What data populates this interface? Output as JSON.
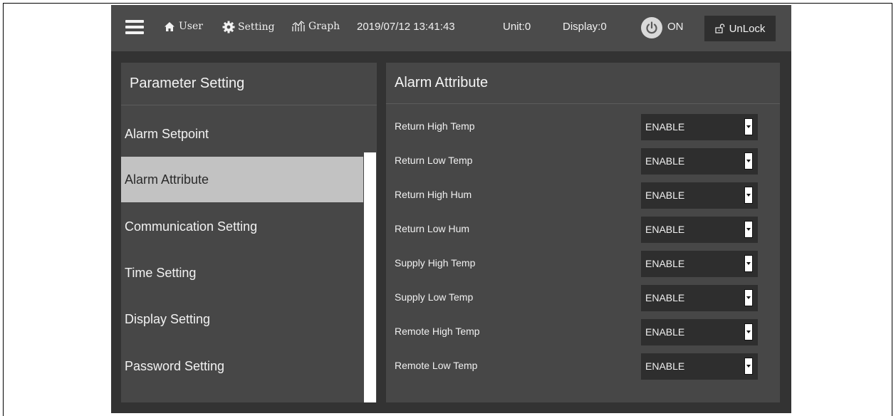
{
  "topbar": {
    "user_label": "User",
    "setting_label": "Setting",
    "graph_label": "Graph",
    "datetime": "2019/07/12 13:41:43",
    "unit": "Unit:0",
    "display": "Display:0",
    "power_label": "ON",
    "unlock_label": "UnLock"
  },
  "left_panel": {
    "title": "Parameter Setting",
    "items": [
      {
        "label": "Alarm Setpoint"
      },
      {
        "label": "Alarm Attribute"
      },
      {
        "label": "Communication Setting"
      },
      {
        "label": "Time Setting"
      },
      {
        "label": "Display Setting"
      },
      {
        "label": "Password Setting"
      }
    ],
    "active_index": 1
  },
  "right_panel": {
    "title": "Alarm Attribute",
    "rows": [
      {
        "label": "Return High Temp",
        "value": "ENABLE"
      },
      {
        "label": "Return Low Temp",
        "value": "ENABLE"
      },
      {
        "label": "Return High Hum",
        "value": "ENABLE"
      },
      {
        "label": "Return Low Hum",
        "value": "ENABLE"
      },
      {
        "label": "Supply High Temp",
        "value": "ENABLE"
      },
      {
        "label": "Supply Low Temp",
        "value": "ENABLE"
      },
      {
        "label": "Remote High Temp",
        "value": "ENABLE"
      },
      {
        "label": "Remote Low Temp",
        "value": "ENABLE"
      }
    ]
  },
  "colors": {
    "screen_bg": "#333333",
    "topbar_bg": "#4b4b4b",
    "panel_bg": "#474747",
    "active_item_bg": "#c2c2c2",
    "select_bg": "#2e2e2e"
  },
  "icons": {
    "menu": "hamburger-icon",
    "user": "home-icon",
    "setting": "gear-icon",
    "graph": "graph-icon",
    "power": "power-icon",
    "unlock": "unlock-icon",
    "dropdown": "dropdown-arrow-icon"
  }
}
